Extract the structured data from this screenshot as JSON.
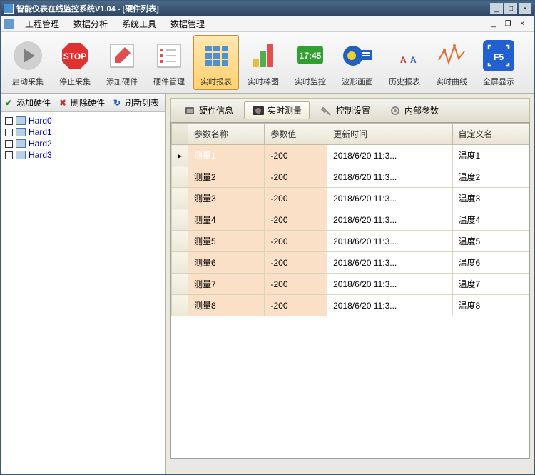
{
  "window": {
    "title": "智能仪表在线监控系统V1.04 - [硬件列表]"
  },
  "menu": {
    "items": [
      "工程管理",
      "数据分析",
      "系统工具",
      "数据管理"
    ]
  },
  "toolbar": {
    "items": [
      {
        "label": "启动采集",
        "icon": "play"
      },
      {
        "label": "停止采集",
        "icon": "stop"
      },
      {
        "label": "添加硬件",
        "icon": "edit"
      },
      {
        "label": "硬件管理",
        "icon": "list"
      },
      {
        "label": "实时报表",
        "icon": "grid",
        "active": true
      },
      {
        "label": "实时棒图",
        "icon": "bar"
      },
      {
        "label": "实时监控",
        "icon": "monitor"
      },
      {
        "label": "波形画面",
        "icon": "wave"
      },
      {
        "label": "历史报表",
        "icon": "font"
      },
      {
        "label": "实时曲线",
        "icon": "curve"
      },
      {
        "label": "全屏显示",
        "icon": "fullscreen"
      }
    ]
  },
  "left": {
    "actions": [
      {
        "label": "添加硬件",
        "icon": "check",
        "color": "#2a8a2a"
      },
      {
        "label": "删除硬件",
        "icon": "x",
        "color": "#cc3030"
      },
      {
        "label": "刷新列表",
        "icon": "refresh",
        "color": "#2050b0"
      }
    ],
    "tree": [
      "Hard0",
      "Hard1",
      "Hard2",
      "Hard3"
    ]
  },
  "tabs": [
    {
      "label": "硬件信息",
      "icon": "chip"
    },
    {
      "label": "实时测量",
      "icon": "gauge",
      "active": true
    },
    {
      "label": "控制设置",
      "icon": "wrench"
    },
    {
      "label": "内部参数",
      "icon": "gear"
    }
  ],
  "table": {
    "headers": [
      "参数名称",
      "参数值",
      "更新时间",
      "自定义名"
    ],
    "rows": [
      {
        "name": "测量1",
        "val": "-200",
        "time": "2018/6/20 11:3...",
        "custom": "温度1",
        "selected": true
      },
      {
        "name": "测量2",
        "val": "-200",
        "time": "2018/6/20 11:3...",
        "custom": "温度2"
      },
      {
        "name": "测量3",
        "val": "-200",
        "time": "2018/6/20 11:3...",
        "custom": "温度3"
      },
      {
        "name": "测量4",
        "val": "-200",
        "time": "2018/6/20 11:3...",
        "custom": "温度4"
      },
      {
        "name": "测量5",
        "val": "-200",
        "time": "2018/6/20 11:3...",
        "custom": "温度5"
      },
      {
        "name": "测量6",
        "val": "-200",
        "time": "2018/6/20 11:3...",
        "custom": "温度6"
      },
      {
        "name": "测量7",
        "val": "-200",
        "time": "2018/6/20 11:3...",
        "custom": "温度7"
      },
      {
        "name": "测量8",
        "val": "-200",
        "time": "2018/6/20 11:3...",
        "custom": "温度8"
      }
    ]
  }
}
